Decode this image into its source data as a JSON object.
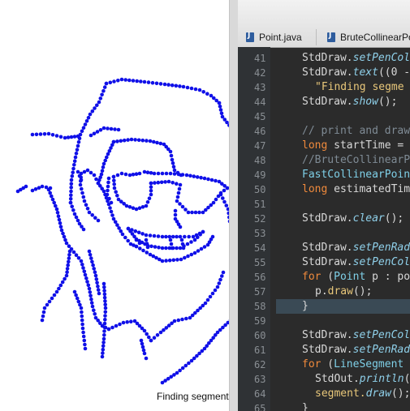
{
  "canvas": {
    "caption": "Finding segments",
    "point_color": "#1010e8"
  },
  "editor": {
    "tabs": [
      {
        "label": "Point.java"
      },
      {
        "label": "BruteCollinearPo"
      }
    ],
    "lines": [
      {
        "num": "41",
        "indent": 1,
        "tokens": [
          {
            "t": "StdDraw.",
            "c": ""
          },
          {
            "t": "setPenCol",
            "c": "mi"
          }
        ]
      },
      {
        "num": "42",
        "indent": 1,
        "tokens": [
          {
            "t": "StdDraw.",
            "c": ""
          },
          {
            "t": "text",
            "c": "mi"
          },
          {
            "t": "((0 -",
            "c": ""
          }
        ]
      },
      {
        "num": "43",
        "indent": 2,
        "tokens": [
          {
            "t": "\"Finding segme",
            "c": "st"
          }
        ]
      },
      {
        "num": "44",
        "indent": 1,
        "tokens": [
          {
            "t": "StdDraw.",
            "c": ""
          },
          {
            "t": "show",
            "c": "mi"
          },
          {
            "t": "();",
            "c": ""
          }
        ]
      },
      {
        "num": "45",
        "indent": 0,
        "tokens": []
      },
      {
        "num": "46",
        "indent": 1,
        "tokens": [
          {
            "t": "// print and draw",
            "c": "cm"
          }
        ]
      },
      {
        "num": "47",
        "indent": 1,
        "tokens": [
          {
            "t": "long",
            "c": "kw"
          },
          {
            "t": " startTime =",
            "c": ""
          }
        ]
      },
      {
        "num": "48",
        "indent": 1,
        "tokens": [
          {
            "t": "//BruteCollinearP",
            "c": "cm"
          }
        ]
      },
      {
        "num": "49",
        "indent": 1,
        "tokens": [
          {
            "t": "FastCollinearPoin",
            "c": "ty"
          }
        ]
      },
      {
        "num": "50",
        "indent": 1,
        "tokens": [
          {
            "t": "long",
            "c": "kw"
          },
          {
            "t": " estimatedTim",
            "c": ""
          }
        ]
      },
      {
        "num": "51",
        "indent": 0,
        "tokens": []
      },
      {
        "num": "52",
        "indent": 1,
        "tokens": [
          {
            "t": "StdDraw.",
            "c": ""
          },
          {
            "t": "clear",
            "c": "mi"
          },
          {
            "t": "();",
            "c": ""
          }
        ]
      },
      {
        "num": "53",
        "indent": 0,
        "tokens": []
      },
      {
        "num": "54",
        "indent": 1,
        "tokens": [
          {
            "t": "StdDraw.",
            "c": ""
          },
          {
            "t": "setPenRad",
            "c": "mi"
          }
        ]
      },
      {
        "num": "55",
        "indent": 1,
        "tokens": [
          {
            "t": "StdDraw.",
            "c": ""
          },
          {
            "t": "setPenCol",
            "c": "mi"
          }
        ]
      },
      {
        "num": "56",
        "indent": 1,
        "tokens": [
          {
            "t": "for",
            "c": "kw"
          },
          {
            "t": " (",
            "c": ""
          },
          {
            "t": "Point",
            "c": "ty"
          },
          {
            "t": " p : po",
            "c": ""
          }
        ]
      },
      {
        "num": "57",
        "indent": 2,
        "tokens": [
          {
            "t": "p.",
            "c": ""
          },
          {
            "t": "draw",
            "c": "st"
          },
          {
            "t": "();",
            "c": ""
          }
        ]
      },
      {
        "num": "58",
        "indent": 1,
        "hl": true,
        "tokens": [
          {
            "t": "}",
            "c": ""
          }
        ]
      },
      {
        "num": "59",
        "indent": 0,
        "tokens": []
      },
      {
        "num": "60",
        "indent": 1,
        "tokens": [
          {
            "t": "StdDraw.",
            "c": ""
          },
          {
            "t": "setPenCol",
            "c": "mi"
          }
        ]
      },
      {
        "num": "61",
        "indent": 1,
        "tokens": [
          {
            "t": "StdDraw.",
            "c": ""
          },
          {
            "t": "setPenRad",
            "c": "mi"
          }
        ]
      },
      {
        "num": "62",
        "indent": 1,
        "tokens": [
          {
            "t": "for",
            "c": "kw"
          },
          {
            "t": " (",
            "c": ""
          },
          {
            "t": "LineSegment",
            "c": "ty"
          }
        ]
      },
      {
        "num": "63",
        "indent": 2,
        "tokens": [
          {
            "t": "StdOut.",
            "c": ""
          },
          {
            "t": "println",
            "c": "mi"
          },
          {
            "t": "(",
            "c": ""
          }
        ]
      },
      {
        "num": "64",
        "indent": 2,
        "tokens": [
          {
            "t": "segment.",
            "c": "st"
          },
          {
            "t": "draw",
            "c": "mi"
          },
          {
            "t": "();",
            "c": ""
          }
        ]
      },
      {
        "num": "65",
        "indent": 1,
        "tokens": [
          {
            "t": "}",
            "c": ""
          }
        ]
      }
    ]
  }
}
